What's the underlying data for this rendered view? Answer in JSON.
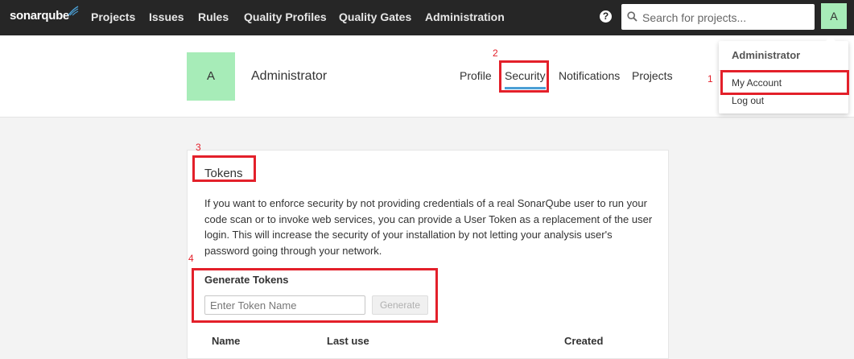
{
  "topnav": {
    "logo": "sonarqube",
    "items": [
      "Projects",
      "Issues",
      "Rules",
      "Quality Profiles",
      "Quality Gates",
      "Administration"
    ],
    "help_glyph": "?",
    "search_placeholder": "Search for projects...",
    "avatar_letter": "A"
  },
  "account": {
    "avatar_letter": "A",
    "name": "Administrator",
    "tabs": [
      "Profile",
      "Security",
      "Notifications",
      "Projects"
    ],
    "active_tab": "Security"
  },
  "dropdown": {
    "header": "Administrator",
    "items": [
      "My Account",
      "Log out"
    ]
  },
  "tokens": {
    "title": "Tokens",
    "description": "If you want to enforce security by not providing credentials of a real SonarQube user to run your code scan or to invoke web services, you can provide a User Token as a replacement of the user login. This will increase the security of your installation by not letting your analysis user's password going through your network.",
    "generate_title": "Generate Tokens",
    "input_placeholder": "Enter Token Name",
    "generate_button": "Generate",
    "columns": [
      "Name",
      "Last use",
      "Created"
    ]
  },
  "annotations": [
    "1",
    "2",
    "3",
    "4"
  ],
  "colors": {
    "topbar": "#262626",
    "avatar": "#a7ecb8",
    "annotation": "#e3202a",
    "active_tab_underline": "#4b9fd5"
  }
}
